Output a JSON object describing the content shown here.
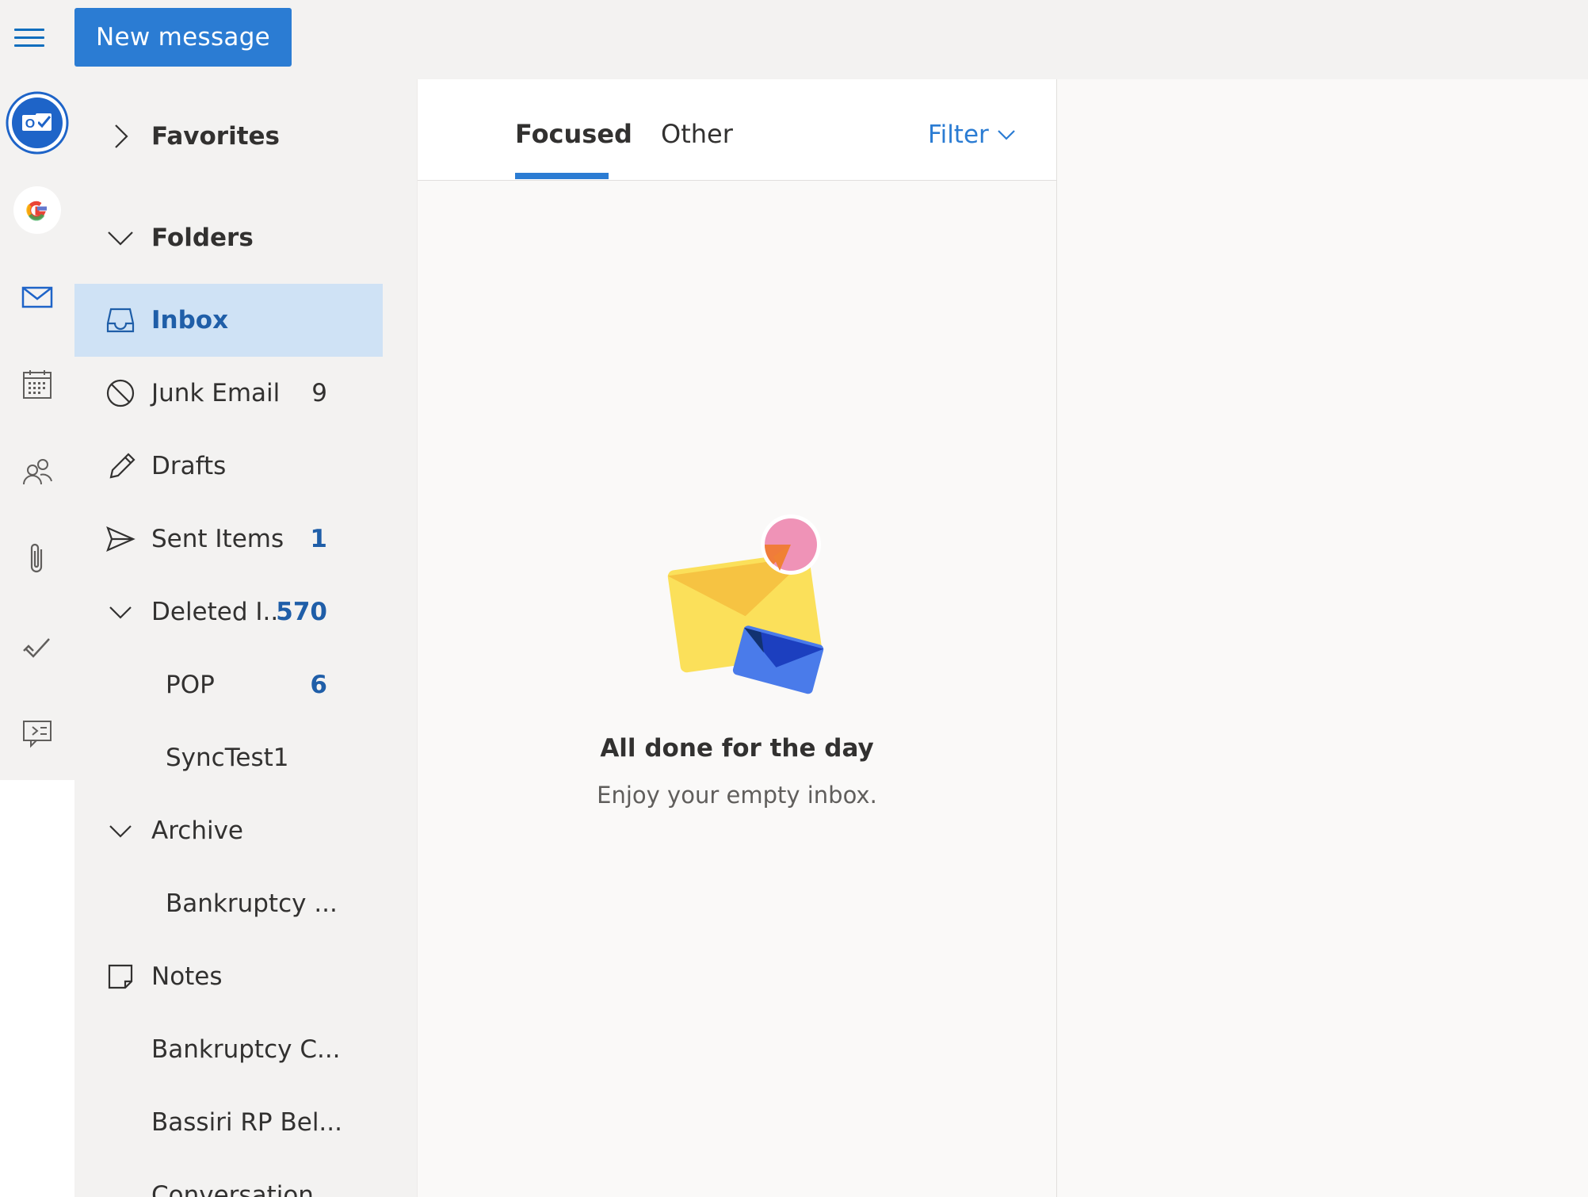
{
  "toolbar": {
    "new_message_label": "New message"
  },
  "rail": {
    "icons": [
      "outlook-icon",
      "google-icon",
      "mail-icon",
      "calendar-icon",
      "people-icon",
      "attachment-icon",
      "todo-icon",
      "yammer-icon"
    ]
  },
  "folders": {
    "favorites": "Favorites",
    "folders_header": "Folders",
    "items": [
      {
        "label": "Inbox",
        "count": ""
      },
      {
        "label": "Junk Email",
        "count": "9"
      },
      {
        "label": "Drafts",
        "count": ""
      },
      {
        "label": "Sent Items",
        "count": "1"
      },
      {
        "label": "Deleted I...",
        "count": "570"
      },
      {
        "label": "POP",
        "count": "6"
      },
      {
        "label": "SyncTest1",
        "count": ""
      },
      {
        "label": "Archive",
        "count": ""
      },
      {
        "label": "Bankruptcy ...",
        "count": ""
      },
      {
        "label": "Notes",
        "count": ""
      },
      {
        "label": "Bankruptcy C...",
        "count": ""
      },
      {
        "label": "Bassiri RP Bel...",
        "count": ""
      },
      {
        "label": "Conversation ...",
        "count": ""
      }
    ]
  },
  "message_list": {
    "tab_focused": "Focused",
    "tab_other": "Other",
    "filter_label": "Filter",
    "empty_title": "All done for the day",
    "empty_subtitle": "Enjoy your empty inbox."
  },
  "colors": {
    "accent": "#2b7cd3",
    "selected_bg": "#cfe2f5",
    "count_blue": "#1f5ea8"
  }
}
